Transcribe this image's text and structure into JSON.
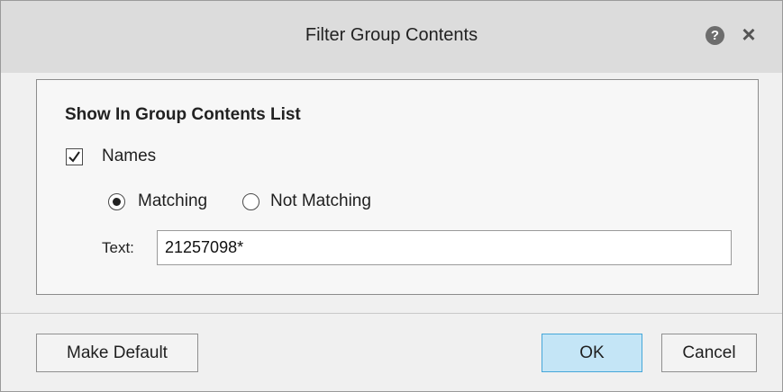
{
  "dialog": {
    "title": "Filter Group Contents",
    "help_icon": "question-mark-icon",
    "close_icon": "close-icon"
  },
  "group": {
    "header": "Show In Group Contents List",
    "names": {
      "label": "Names",
      "checked": true
    },
    "match_mode": {
      "options": [
        "Matching",
        "Not Matching"
      ],
      "selected": "Matching"
    },
    "text": {
      "label": "Text:",
      "value": "21257098*"
    }
  },
  "buttons": {
    "make_default": "Make Default",
    "ok": "OK",
    "cancel": "Cancel"
  },
  "colors": {
    "ok_button_fill": "#c4e5f6",
    "ok_button_border": "#46a7d9",
    "titlebar": "#dcdcdc"
  }
}
